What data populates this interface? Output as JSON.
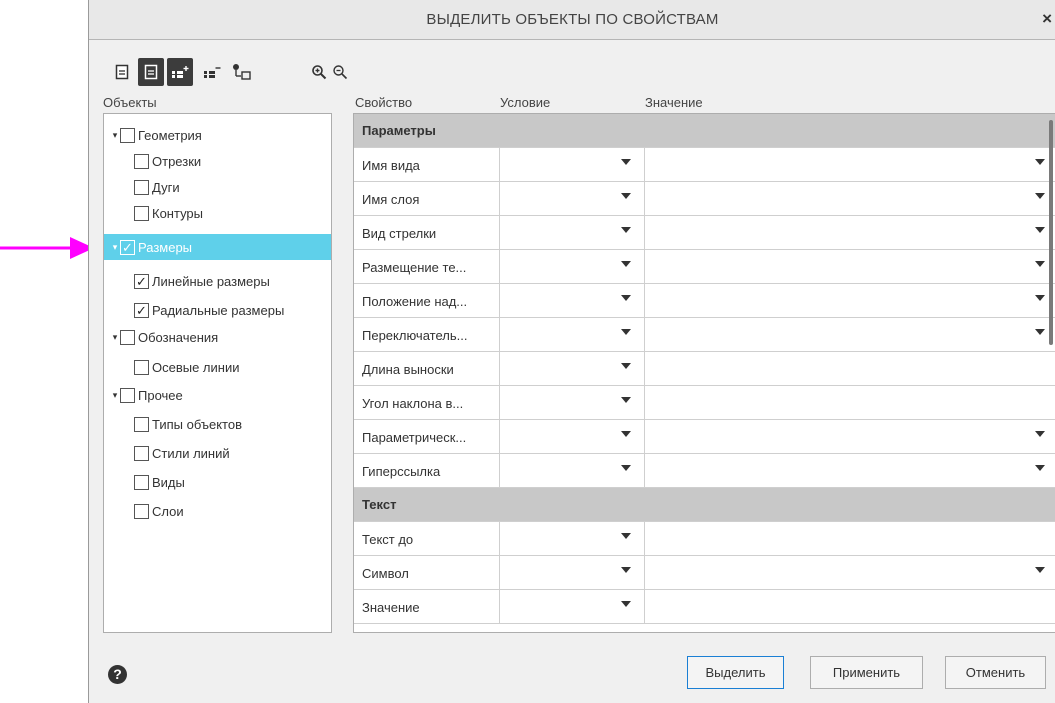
{
  "dialog": {
    "title": "ВЫДЕЛИТЬ ОБЪЕКТЫ ПО СВОЙСТВАМ",
    "close_label": "×"
  },
  "toolbar": {
    "icons": [
      "document-icon",
      "document-filter-icon",
      "add-filter-icon",
      "remove-filter-icon",
      "hierarchy-icon",
      "zoom-in-icon",
      "zoom-out-icon"
    ],
    "active_icon": "document-filter-icon"
  },
  "tree": {
    "header": "Объекты",
    "items": [
      {
        "label": "Геометрия",
        "expander": "▾",
        "checked": false,
        "selected": false
      },
      {
        "label": "Отрезки",
        "checked": false,
        "selected": false
      },
      {
        "label": "Дуги",
        "checked": false,
        "selected": false
      },
      {
        "label": "Контуры",
        "checked": false,
        "selected": false
      },
      {
        "label": "Размеры",
        "expander": "▾",
        "checked": true,
        "selected": true
      },
      {
        "label": "Линейные размеры",
        "checked": true,
        "selected": false
      },
      {
        "label": "Радиальные размеры",
        "checked": true,
        "selected": false
      },
      {
        "label": "Обозначения",
        "expander": "▾",
        "checked": false,
        "selected": false
      },
      {
        "label": "Осевые линии",
        "checked": false,
        "selected": false
      },
      {
        "label": "Прочее",
        "expander": "▾",
        "checked": false,
        "selected": false
      },
      {
        "label": "Типы объектов",
        "checked": false,
        "selected": false
      },
      {
        "label": "Стили линий",
        "checked": false,
        "selected": false
      },
      {
        "label": "Виды",
        "checked": false,
        "selected": false
      },
      {
        "label": "Слои",
        "checked": false,
        "selected": false
      }
    ]
  },
  "grid": {
    "headers": {
      "property": "Свойство",
      "condition": "Условие",
      "value": "Значение"
    },
    "rows": [
      {
        "group": "Параметры"
      },
      {
        "property": "Имя вида",
        "value_dropdown": true
      },
      {
        "property": "Имя слоя",
        "value_dropdown": true
      },
      {
        "property": "Вид стрелки",
        "value_dropdown": true
      },
      {
        "property": "Размещение те...",
        "value_dropdown": true
      },
      {
        "property": "Положение над...",
        "value_dropdown": true
      },
      {
        "property": "Переключатель...",
        "value_dropdown": true
      },
      {
        "property": "Длина выноски",
        "value_dropdown": false
      },
      {
        "property": "Угол наклона в...",
        "value_dropdown": false
      },
      {
        "property": "Параметрическ...",
        "value_dropdown": true
      },
      {
        "property": "Гиперссылка",
        "value_dropdown": true
      },
      {
        "group": "Текст"
      },
      {
        "property": "Текст до",
        "value_dropdown": false
      },
      {
        "property": "Символ",
        "value_dropdown": true
      },
      {
        "property": "Значение",
        "value_dropdown": false
      }
    ]
  },
  "footer": {
    "help_label": "?",
    "buttons": {
      "select": "Выделить",
      "apply": "Применить",
      "cancel": "Отменить"
    }
  },
  "colors": {
    "selection": "#5fd0ea",
    "annotation_arrow": "#ff00ff",
    "primary_border": "#1a7fd4"
  }
}
